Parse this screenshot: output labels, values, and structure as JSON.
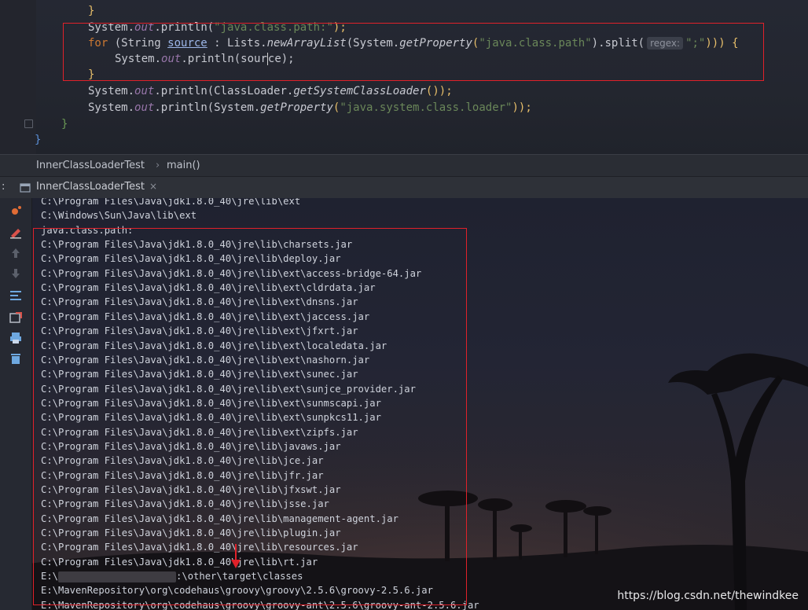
{
  "editor": {
    "lines": {
      "l1": "}",
      "l2_a": "System.",
      "l2_b": "out",
      "l2_c": ".println(",
      "l2_d": "\"java.class.path:\"",
      "l2_e": ");",
      "l3_a": "for",
      "l3_b": " (String ",
      "l3_c": "source",
      "l3_d": " : Lists.",
      "l3_e": "newArrayList",
      "l3_f": "(System.",
      "l3_g": "getProperty",
      "l3_h": "(",
      "l3_i": "\"java.class.path\"",
      "l3_j": ").split(",
      "l3_hint": "regex:",
      "l3_k": "\";\"",
      "l3_l": "))) {",
      "l4_a": "System.",
      "l4_b": "out",
      "l4_c": ".println(",
      "l4_d": "sour",
      "l4_e": "ce);",
      "l5": "}",
      "l6_a": "System.",
      "l6_b": "out",
      "l6_c": ".println(ClassLoader.",
      "l6_d": "getSystemClassLoader",
      "l6_e": "());",
      "l7_a": "System.",
      "l7_b": "out",
      "l7_c": ".println(System.",
      "l7_d": "getProperty",
      "l7_e": "(",
      "l7_f": "\"java.system.class.loader\"",
      "l7_g": "));",
      "l8": "}",
      "l9": "}"
    }
  },
  "breadcrumb": {
    "class_name": "InnerClassLoaderTest",
    "separator": "›",
    "method": "main()"
  },
  "run_tab": {
    "prefix": ":",
    "label": "InnerClassLoaderTest",
    "close": "×"
  },
  "console": {
    "lines": [
      "C:\\Program Files\\Java\\jdk1.8.0_40\\jre\\lib\\ext",
      "C:\\Windows\\Sun\\Java\\lib\\ext",
      "java.class.path:",
      "C:\\Program Files\\Java\\jdk1.8.0_40\\jre\\lib\\charsets.jar",
      "C:\\Program Files\\Java\\jdk1.8.0_40\\jre\\lib\\deploy.jar",
      "C:\\Program Files\\Java\\jdk1.8.0_40\\jre\\lib\\ext\\access-bridge-64.jar",
      "C:\\Program Files\\Java\\jdk1.8.0_40\\jre\\lib\\ext\\cldrdata.jar",
      "C:\\Program Files\\Java\\jdk1.8.0_40\\jre\\lib\\ext\\dnsns.jar",
      "C:\\Program Files\\Java\\jdk1.8.0_40\\jre\\lib\\ext\\jaccess.jar",
      "C:\\Program Files\\Java\\jdk1.8.0_40\\jre\\lib\\ext\\jfxrt.jar",
      "C:\\Program Files\\Java\\jdk1.8.0_40\\jre\\lib\\ext\\localedata.jar",
      "C:\\Program Files\\Java\\jdk1.8.0_40\\jre\\lib\\ext\\nashorn.jar",
      "C:\\Program Files\\Java\\jdk1.8.0_40\\jre\\lib\\ext\\sunec.jar",
      "C:\\Program Files\\Java\\jdk1.8.0_40\\jre\\lib\\ext\\sunjce_provider.jar",
      "C:\\Program Files\\Java\\jdk1.8.0_40\\jre\\lib\\ext\\sunmscapi.jar",
      "C:\\Program Files\\Java\\jdk1.8.0_40\\jre\\lib\\ext\\sunpkcs11.jar",
      "C:\\Program Files\\Java\\jdk1.8.0_40\\jre\\lib\\ext\\zipfs.jar",
      "C:\\Program Files\\Java\\jdk1.8.0_40\\jre\\lib\\javaws.jar",
      "C:\\Program Files\\Java\\jdk1.8.0_40\\jre\\lib\\jce.jar",
      "C:\\Program Files\\Java\\jdk1.8.0_40\\jre\\lib\\jfr.jar",
      "C:\\Program Files\\Java\\jdk1.8.0_40\\jre\\lib\\jfxswt.jar",
      "C:\\Program Files\\Java\\jdk1.8.0_40\\jre\\lib\\jsse.jar",
      "C:\\Program Files\\Java\\jdk1.8.0_40\\jre\\lib\\management-agent.jar",
      "C:\\Program Files\\Java\\jdk1.8.0_40\\jre\\lib\\plugin.jar",
      "C:\\Program Files\\Java\\jdk1.8.0_40\\jre\\lib\\resources.jar",
      "C:\\Program Files\\Java\\jdk1.8.0_40\\jre\\lib\\rt.jar",
      "E:\\",
      "E:\\MavenRepository\\org\\codehaus\\groovy\\groovy\\2.5.6\\groovy-2.5.6.jar",
      "E:\\MavenRepository\\org\\codehaus\\groovy\\groovy-ant\\2.5.6\\groovy-ant-2.5.6.jar"
    ],
    "redacted_suffix": ":\\other\\target\\classes"
  },
  "watermark": "https://blog.csdn.net/thewindkee",
  "icons": [
    "rerun-icon",
    "edit-icon",
    "up-arrow-icon",
    "down-arrow-icon",
    "soft-wrap-icon",
    "scroll-to-end-icon",
    "print-icon",
    "trash-icon"
  ],
  "colors": {
    "highlight_box": "#e0212a",
    "string": "#6a8759",
    "keyword": "#cc7832",
    "field": "#9876aa"
  }
}
